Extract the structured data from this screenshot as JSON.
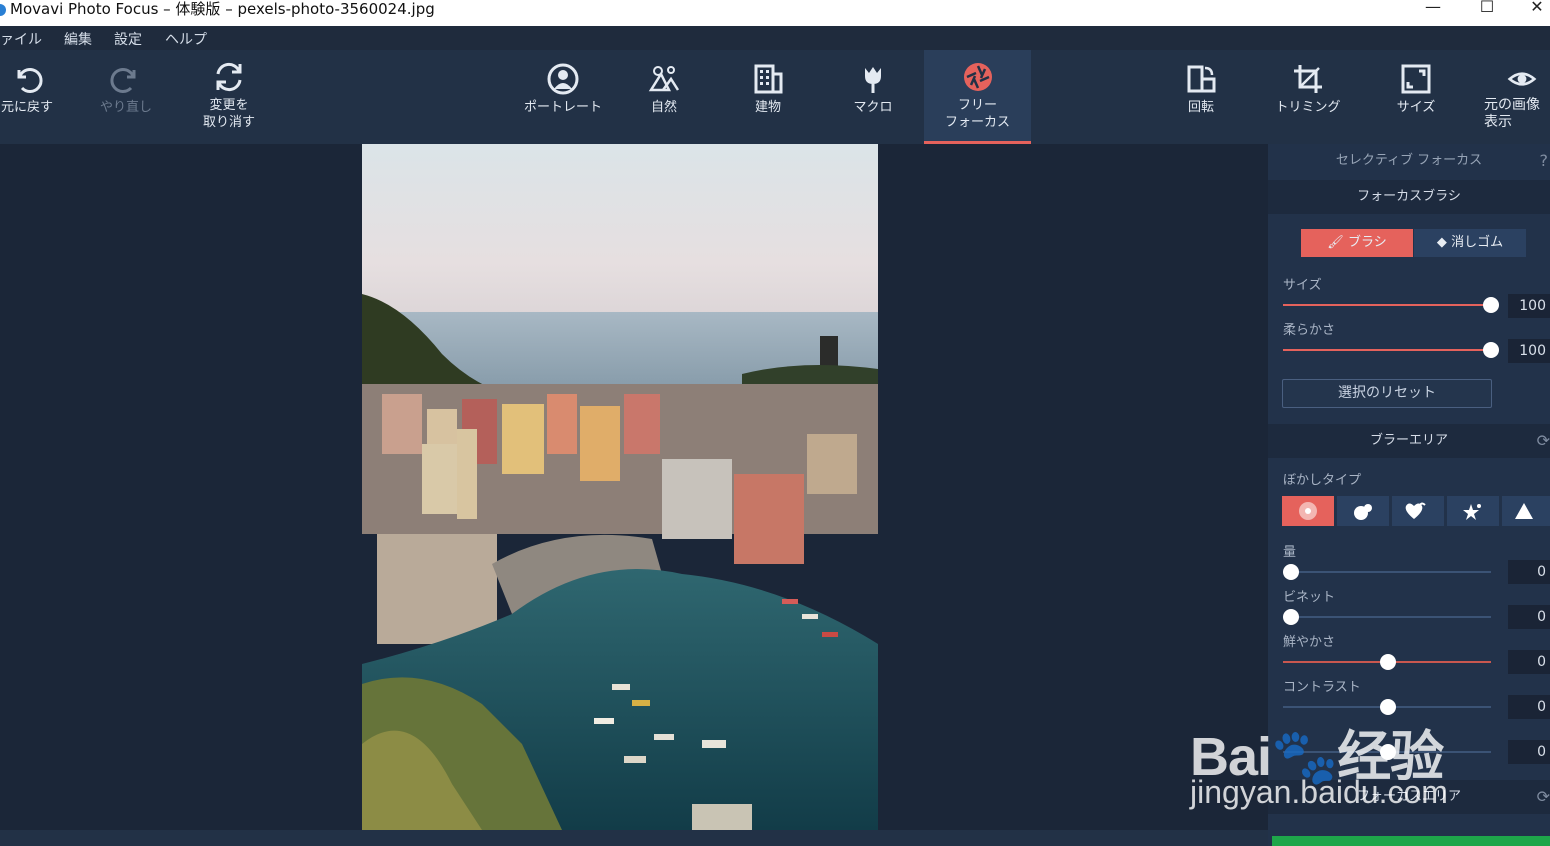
{
  "window": {
    "title": "Movavi Photo Focus – 体験版 – pexels-photo-3560024.jpg",
    "minimize": "—",
    "maximize": "☐",
    "close": "✕"
  },
  "menu": [
    "ァイル",
    "編集",
    "設定",
    "ヘルプ"
  ],
  "toolbar": {
    "undo": "元に戻す",
    "redo": "やり直し",
    "reset": "変更を\n取り消す",
    "portrait": "ポートレート",
    "nature": "自然",
    "building": "建物",
    "macro": "マクロ",
    "free_focus": "フリー\nフォーカス",
    "rotate": "回転",
    "crop": "トリミング",
    "resize": "サイズ",
    "show_original": "元の画像\n表示"
  },
  "panel": {
    "selective_focus": "セレクティブ フォーカス",
    "help": "?",
    "focus_brush_header": "フォーカスブラシ",
    "brush": "ブラシ",
    "eraser": "消しゴム",
    "size_label": "サイズ",
    "size_value": "100",
    "size_fraction": 1.0,
    "softness_label": "柔らかさ",
    "softness_value": "100",
    "softness_fraction": 1.0,
    "reset_selection": "選択のリセット",
    "blur_area_header": "ブラーエリア",
    "blur_type_label": "ぼかしタイプ",
    "blur_types": [
      "radial-icon",
      "circles-icon",
      "hearts-icon",
      "stars-icon",
      "triangles-icon"
    ],
    "amount_label": "量",
    "amount_value": "0",
    "vignette_label": "ビネット",
    "vignette_value": "0",
    "vibrance_label": "鮮やかさ",
    "vibrance_value": "0",
    "contrast_label": "コントラスト",
    "contrast_value": "0",
    "extra_value": "0",
    "focus_area_header": "フォーカスエリア"
  },
  "watermark": {
    "brand": "Bai🐾经验",
    "url": "jingyan.baidu.com"
  },
  "colors": {
    "accent": "#e5625c",
    "panel": "#22324a",
    "toolbar": "#223146",
    "canvas": "#1b2638",
    "save": "#1ea64a"
  }
}
